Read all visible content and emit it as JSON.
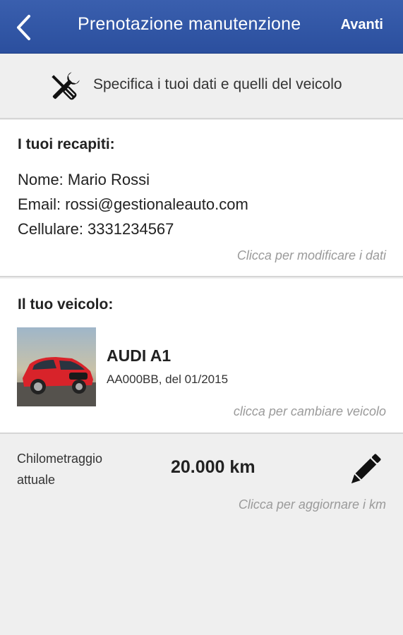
{
  "appbar": {
    "back_icon": "chevron-left-icon",
    "title": "Prenotazione manutenzione",
    "next_label": "Avanti",
    "color": "#2f52a2"
  },
  "info": {
    "icon": "tools-icon",
    "text": "Specifica i tuoi dati e quelli del veicolo"
  },
  "contacts": {
    "title": "I tuoi recapiti:",
    "name": "Nome: Mario Rossi",
    "email": "Email: rossi@gestionaleauto.com",
    "phone": "Cellulare: 3331234567",
    "hint": "Clicca per modificare i dati"
  },
  "vehicle": {
    "title": "Il tuo veicolo:",
    "model": "AUDI A1",
    "plate_date": "AA000BB, del 01/2015",
    "hint": "clicca per cambiare veicolo",
    "photo_color": "#d8232a"
  },
  "mileage": {
    "label": "Chilometraggio attuale",
    "value": "20.000 km",
    "edit_icon": "pencil-icon",
    "hint": "Clicca per aggiornare i km"
  }
}
